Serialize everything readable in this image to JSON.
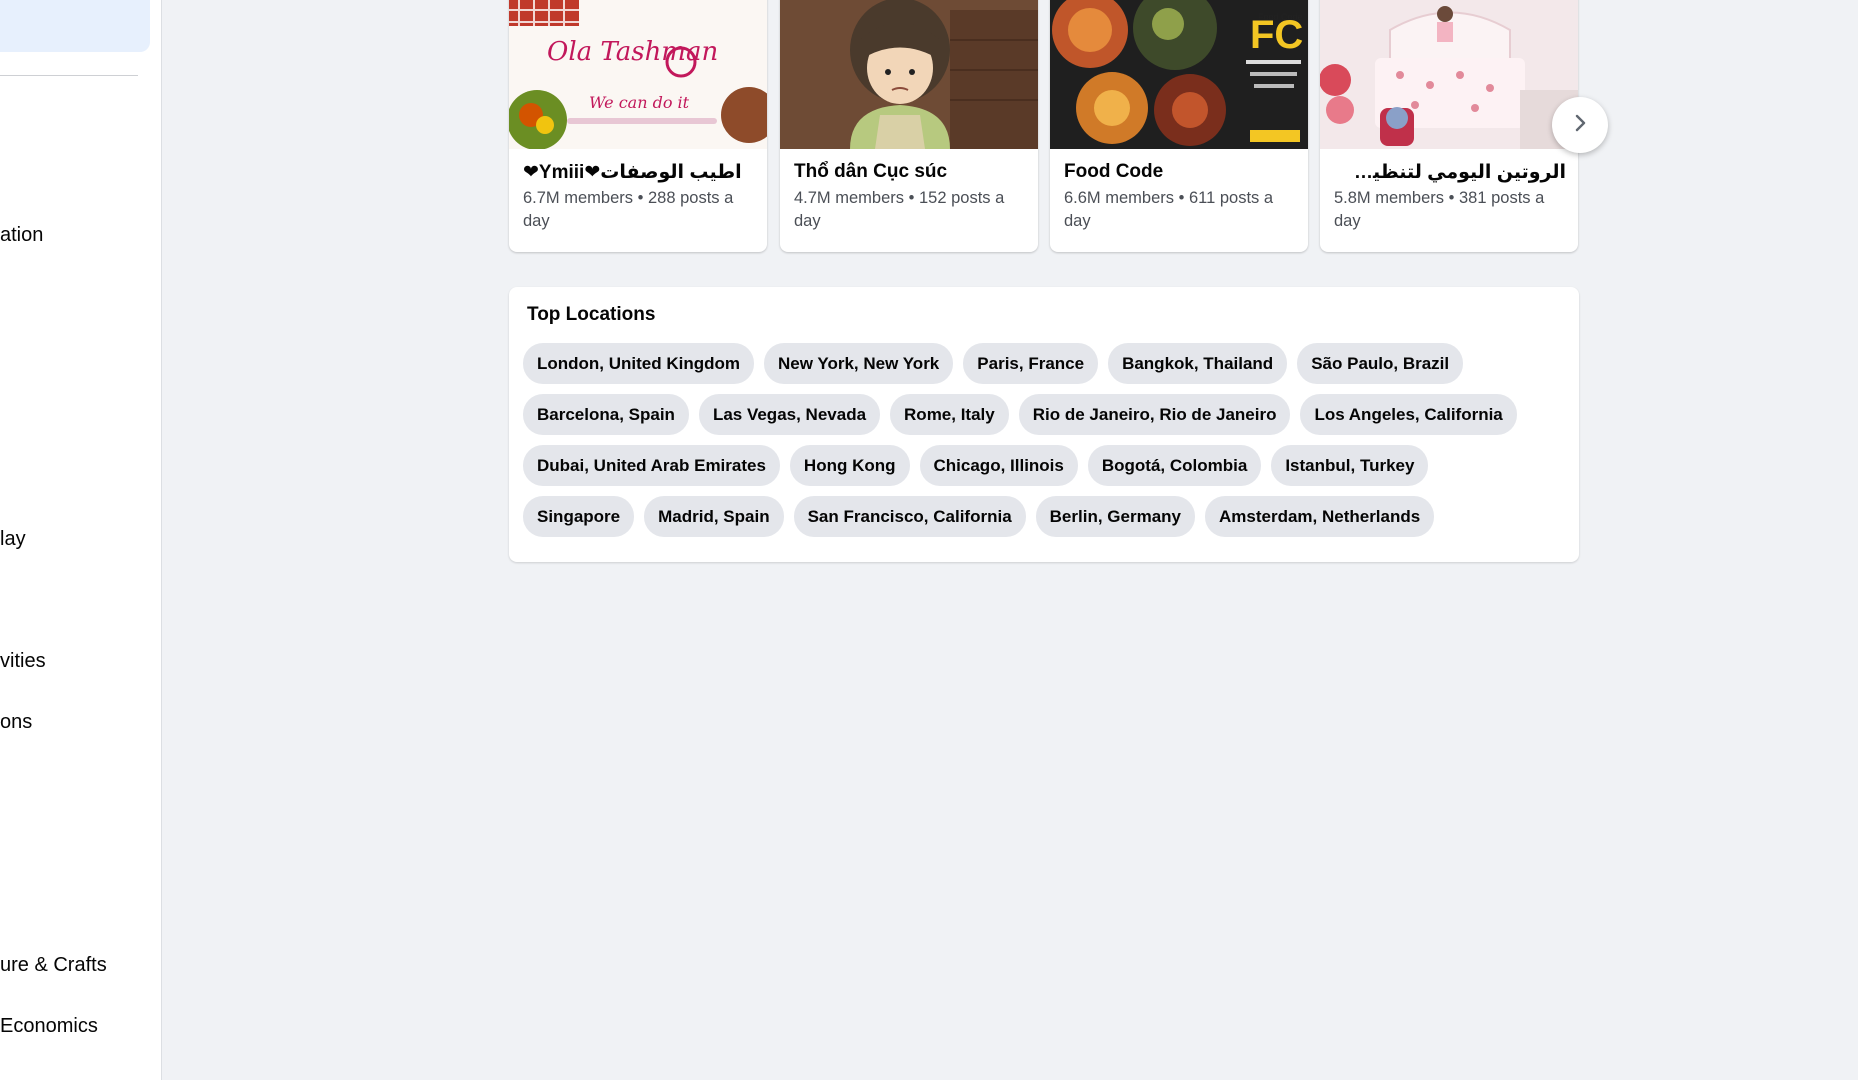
{
  "sidebar": {
    "items": [
      {
        "label": "ation"
      },
      {
        "label": "lay"
      },
      {
        "label": "vities"
      },
      {
        "label": "ons"
      },
      {
        "label": "ure & Crafts"
      },
      {
        "label": " Economics"
      }
    ]
  },
  "groups": [
    {
      "name": "❤Ymiii❤اطيب الوصفات",
      "meta": "6.7M members • 288 posts a day"
    },
    {
      "name": "Thổ dân Cục súc",
      "meta": "4.7M members • 152 posts a day"
    },
    {
      "name": "Food Code",
      "meta": "6.6M members • 611 posts a day"
    },
    {
      "name": "الروتين اليومي لتنظيف وت...",
      "meta": "5.8M members • 381 posts a day"
    }
  ],
  "card_images": {
    "card1": {
      "brand_text": "Ola Tashman",
      "subtext": "We can do it"
    },
    "card3": {
      "logo": "FC",
      "logo_caption": "Food Code"
    }
  },
  "top_locations": {
    "title": "Top Locations",
    "rows": [
      [
        "London, United Kingdom",
        "New York, New York",
        "Paris, France",
        "Bangkok, Thailand",
        "São Paulo, Brazil"
      ],
      [
        "Barcelona, Spain",
        "Las Vegas, Nevada",
        "Rome, Italy",
        "Rio de Janeiro, Rio de Janeiro",
        "Los Angeles, California"
      ],
      [
        "Dubai, United Arab Emirates",
        "Hong Kong",
        "Chicago, Illinois",
        "Bogotá, Colombia",
        "Istanbul, Turkey"
      ],
      [
        "Singapore",
        "Madrid, Spain",
        "San Francisco, California",
        "Berlin, Germany",
        "Amsterdam, Netherlands"
      ]
    ]
  },
  "icons": {
    "next": "chevron-right-icon"
  },
  "colors": {
    "background": "#f0f2f5",
    "chip": "#e4e6eb",
    "active_nav": "#e7f0fd"
  }
}
